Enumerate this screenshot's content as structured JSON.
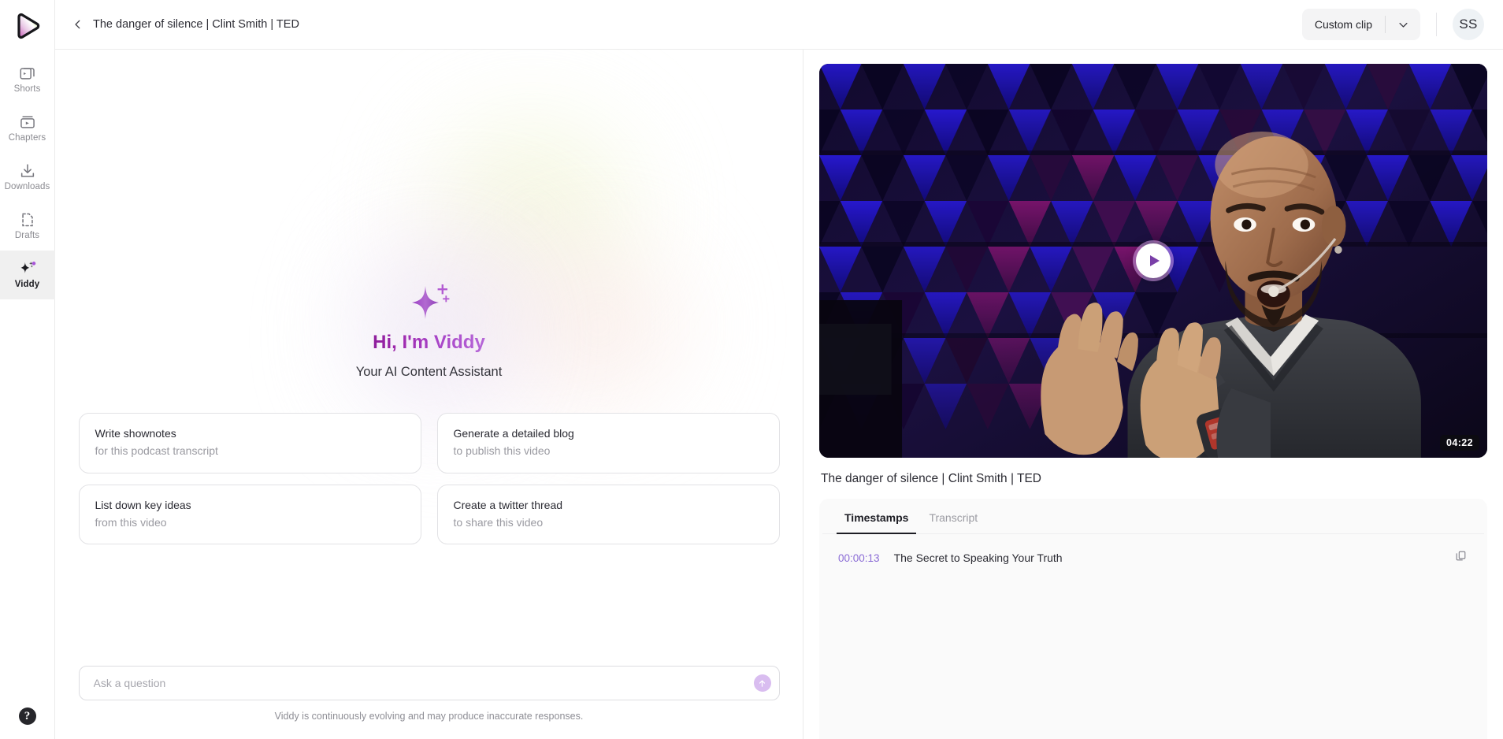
{
  "sidebar": {
    "logo_name": "app-logo",
    "items": [
      {
        "label": "Shorts",
        "icon": "shorts-icon",
        "active": false
      },
      {
        "label": "Chapters",
        "icon": "chapters-icon",
        "active": false
      },
      {
        "label": "Downloads",
        "icon": "downloads-icon",
        "active": false
      },
      {
        "label": "Drafts",
        "icon": "drafts-icon",
        "active": false
      },
      {
        "label": "Viddy",
        "icon": "sparkle-icon",
        "active": true
      }
    ],
    "help_label": "?"
  },
  "header": {
    "back_icon": "chevron-left-icon",
    "title": "The danger of silence | Clint Smith | TED",
    "clip_label": "Custom clip",
    "clip_caret_icon": "chevron-down-icon",
    "avatar_initials": "SS"
  },
  "assistant": {
    "logo_icon": "sparkle-icon",
    "greeting": "Hi, I'm Viddy",
    "subtitle": "Your AI Content Assistant",
    "suggestions": [
      {
        "title": "Write shownotes",
        "subtitle": "for this podcast transcript"
      },
      {
        "title": "Generate a detailed blog",
        "subtitle": "to publish this video"
      },
      {
        "title": "List down key ideas",
        "subtitle": "from this video"
      },
      {
        "title": "Create a twitter thread",
        "subtitle": "to share this video"
      }
    ],
    "composer": {
      "value": "",
      "placeholder": "Ask a question",
      "send_icon": "arrow-up-icon"
    },
    "disclaimer": "Viddy is continuously evolving and may produce inaccurate responses."
  },
  "video": {
    "play_icon": "play-icon",
    "duration": "04:22",
    "title": "The danger of silence | Clint Smith | TED",
    "tabs": [
      {
        "label": "Timestamps",
        "active": true
      },
      {
        "label": "Transcript",
        "active": false
      }
    ],
    "timestamps": [
      {
        "time": "00:00:13",
        "text": "The Secret to Speaking Your Truth",
        "copy_icon": "copy-icon"
      }
    ]
  },
  "colors": {
    "accent_purple": "#8b6cd6",
    "brand_gradient_start": "#8e1f9c",
    "brand_gradient_end": "#b668d8",
    "send_button": "#d9bdf0",
    "active_nav_bg": "#f0f0f0"
  }
}
